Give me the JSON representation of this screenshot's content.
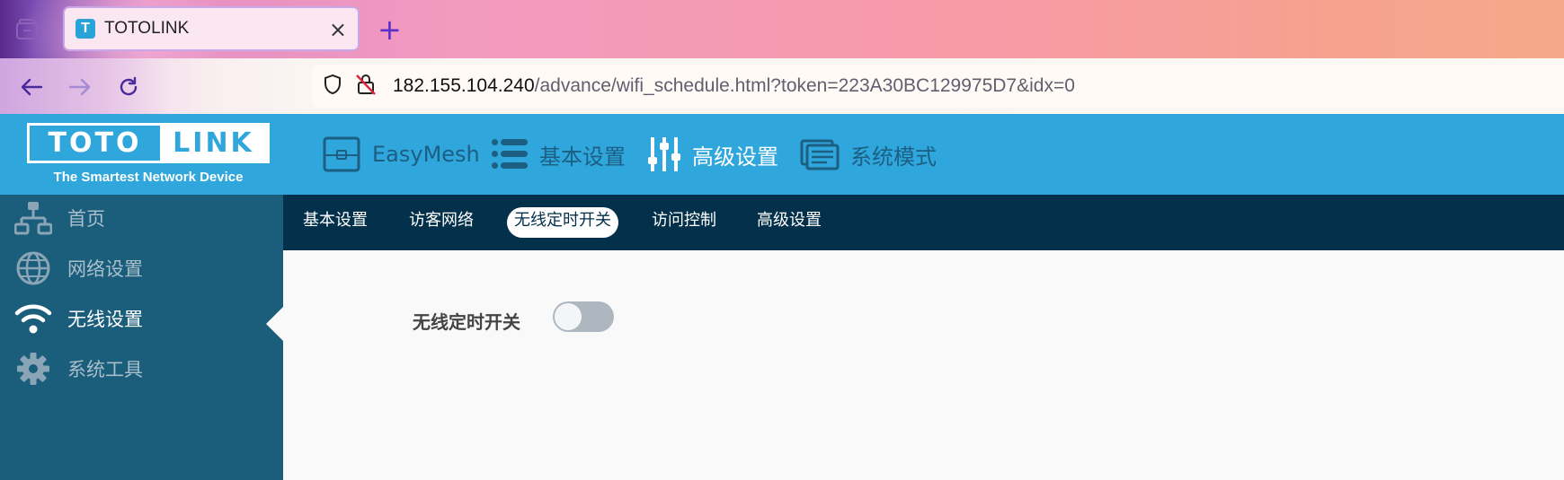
{
  "browser": {
    "tab_title": "TOTOLINK",
    "tab_favicon_letter": "T",
    "url_host": "182.155.104.240",
    "url_path": "/advance/wifi_schedule.html?token=223A30BC129975D7&idx=0"
  },
  "header": {
    "logo_left": "TOTO",
    "logo_right": "LINK",
    "tagline": "The Smartest Network Device",
    "nav": [
      {
        "label": "EasyMesh",
        "icon": "mesh-router-icon",
        "active": false
      },
      {
        "label": "基本设置",
        "icon": "list-icon",
        "active": false
      },
      {
        "label": "高级设置",
        "icon": "sliders-icon",
        "active": true
      },
      {
        "label": "系统模式",
        "icon": "mode-icon",
        "active": false
      }
    ]
  },
  "sidebar": {
    "items": [
      {
        "label": "首页",
        "icon": "network-tree-icon",
        "active": false
      },
      {
        "label": "网络设置",
        "icon": "globe-icon",
        "active": false
      },
      {
        "label": "无线设置",
        "icon": "wifi-icon",
        "active": true
      },
      {
        "label": "系统工具",
        "icon": "gear-icon",
        "active": false
      }
    ]
  },
  "subnav": {
    "tabs": [
      {
        "label": "基本设置",
        "active": false
      },
      {
        "label": "访客网络",
        "active": false
      },
      {
        "label": "无线定时开关",
        "active": true
      },
      {
        "label": "访问控制",
        "active": false
      },
      {
        "label": "高级设置",
        "active": false
      }
    ]
  },
  "content": {
    "schedule_label": "无线定时开关",
    "schedule_enabled": false
  },
  "colors": {
    "header_bg": "#2fa6dc",
    "sidebar_bg": "#1b5e7c",
    "subnav_bg": "#03304a",
    "content_bg": "#f9f9f9",
    "toggle_off": "#aeb7c0"
  }
}
